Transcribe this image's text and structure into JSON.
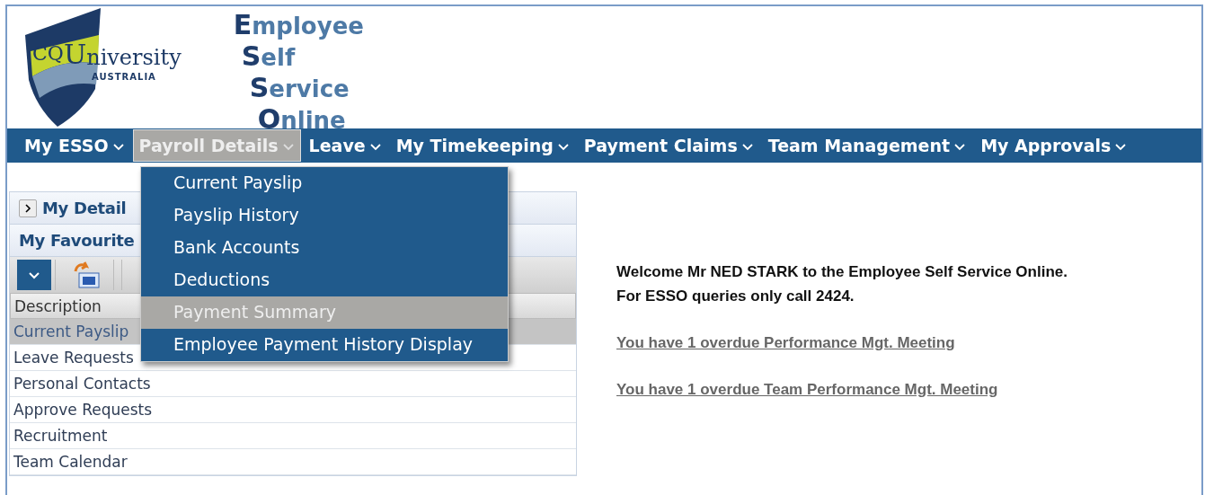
{
  "logo": {
    "initials": "CQ",
    "name_rest": "niversity",
    "name_initial": "U",
    "country": "AUSTRALIA"
  },
  "app_title": [
    "**E**mployee",
    "**S**elf",
    "**S**ervice",
    "**O**nline"
  ],
  "nav": [
    {
      "label": "My ESSO",
      "selected": false
    },
    {
      "label": "Payroll Details",
      "selected": true
    },
    {
      "label": "Leave",
      "selected": false
    },
    {
      "label": "My Timekeeping",
      "selected": false
    },
    {
      "label": "Payment Claims",
      "selected": false
    },
    {
      "label": "Team Management",
      "selected": false
    },
    {
      "label": "My Approvals",
      "selected": false
    }
  ],
  "dropdown": [
    {
      "label": "Current Payslip",
      "selected": false
    },
    {
      "label": "Payslip History",
      "selected": false
    },
    {
      "label": "Bank Accounts",
      "selected": false
    },
    {
      "label": "Deductions",
      "selected": false
    },
    {
      "label": "Payment Summary",
      "selected": true
    },
    {
      "label": "Employee Payment History Display",
      "selected": false
    }
  ],
  "panel": {
    "details_title": "My Detail",
    "favourites_title": "My Favourite",
    "column": "Description",
    "rows": [
      {
        "label": "Current Payslip",
        "selected": true
      },
      {
        "label": "Leave Requests",
        "selected": false
      },
      {
        "label": "Personal Contacts",
        "selected": false
      },
      {
        "label": "Approve Requests",
        "selected": false
      },
      {
        "label": "Recruitment",
        "selected": false
      },
      {
        "label": "Team Calendar",
        "selected": false
      }
    ]
  },
  "welcome": [
    "Welcome Mr NED STARK to the Employee Self Service Online.",
    "For ESSO queries only call 2424."
  ],
  "links": [
    "You have 1 overdue Performance Mgt. Meeting",
    "You have 1 overdue Team Performance Mgt. Meeting"
  ]
}
